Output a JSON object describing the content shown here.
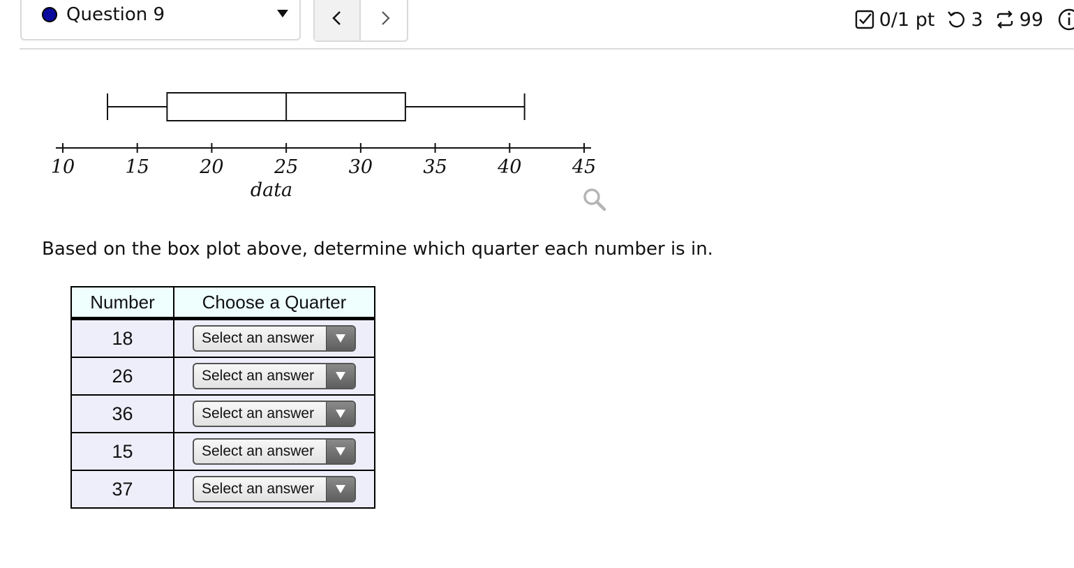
{
  "header": {
    "question_label": "Question 9",
    "prev_icon": "chevron-left-icon",
    "next_icon": "chevron-right-icon",
    "score": "0/1 pt",
    "retries": "3",
    "attempts": "99"
  },
  "chart_data": {
    "type": "box",
    "xlabel": "data",
    "ticks": [
      10,
      15,
      20,
      25,
      30,
      35,
      40,
      45
    ],
    "xlim": [
      10,
      45
    ],
    "min": 13,
    "q1": 17,
    "median": 25,
    "q3": 33,
    "max": 41
  },
  "prompt": "Based on the box plot above, determine which quarter each number is in.",
  "table": {
    "headers": [
      "Number",
      "Choose a Quarter"
    ],
    "rows": [
      {
        "number": "18",
        "select": "Select an answer"
      },
      {
        "number": "26",
        "select": "Select an answer"
      },
      {
        "number": "36",
        "select": "Select an answer"
      },
      {
        "number": "15",
        "select": "Select an answer"
      },
      {
        "number": "37",
        "select": "Select an answer"
      }
    ]
  },
  "colors": {
    "question_dot": "#0a0a9e",
    "header_cell": "#eefffe",
    "body_cell": "#eeeefb"
  }
}
